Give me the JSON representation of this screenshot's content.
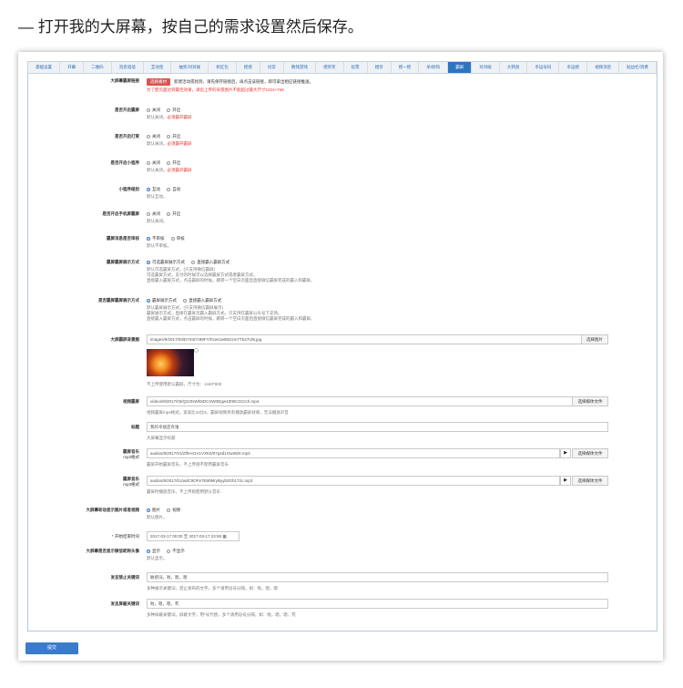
{
  "heading": "— 打开我的大屏幕，按自己的需求设置然后保存。",
  "tabs": [
    "基础设置",
    "开幕",
    "二维码",
    "消息墙墙",
    "互动签",
    "抽奖/对对碰",
    "抢红包",
    "摇摇",
    "问答",
    "数钱游戏",
    "摇奖奖",
    "投票",
    "相亲",
    "摇一摇",
    "杀/射钩",
    "霸屏",
    "对对碰",
    "大转盘",
    "幸运号码",
    "幸运榜",
    "视频消息",
    "贴边栏/消费"
  ],
  "active_tab": "霸屏",
  "form": {
    "bg_upload": {
      "label": "大屏幕霸屏链接",
      "button": "选择素材",
      "text": "新建活动或找到，请先保存链接后，再点击该链接，即可拿出相应链接推送。",
      "note": "为了使页面达到最佳效果，请您上传的背景图片不能超过最大尺寸1024×768"
    },
    "open_screen": {
      "label": "是否开启霸屏",
      "opt1": "关闭",
      "opt2": "开启",
      "hint": "默认关闭，",
      "hint_red": "必须霸开霸屏"
    },
    "open_danmu": {
      "label": "是否开启打赏",
      "opt1": "关闭",
      "opt2": "开启",
      "hint": "默认关闭，",
      "hint_red": "必须霸开霸屏"
    },
    "open_gift": {
      "label": "是否开启小程序",
      "opt1": "关闭",
      "opt2": "开启",
      "hint": "默认关闭，",
      "hint_red": "必须霸开霸屏"
    },
    "mini_level": {
      "label": "小程序级别",
      "opt1": "互动",
      "opt2": "自动",
      "hint": "默认互动。"
    },
    "phone_screen": {
      "label": "是否开启手机屏霸屏",
      "opt1": "关闭",
      "opt2": "开启",
      "hint": "默认关闭。"
    },
    "msg_review": {
      "label": "霸屏消息是否审核",
      "opt1": "不审核",
      "opt2": "审核",
      "hint": "默认不审核。"
    },
    "pay_method": {
      "label": "霸屏霸屏展示方式",
      "opt1": "可选霸屏展示方式",
      "opt2": "直接霸入霸屏方式",
      "hints": [
        "默认可选霸屏方式，(只支持微信霸屏)",
        "可选霸屏方式，支付的时候可以选择霸屏方式或者霸屏方式。",
        "直接霸入霸屏方式，点击霸屏的时候，跳转一个空白页面后直接微信霸屏完成的霸入和霸屏。"
      ]
    },
    "show_method": {
      "label": "是否霸屏霸屏展示方式",
      "opt1": "霸屏展示方式",
      "opt2": "直接霸入霸屏方式",
      "hints": [
        "默认霸屏展示方式，(只支持微信霸屏展示)",
        "霸屏展示方式，直接在霸屏页霸入霸屏方式，只支持在霸屏公众号下支持。",
        "直接霸入霸屏方式，点击霸屏的时候，跳转一个空白页面后直接微信霸屏完成的霸入和霸屏。"
      ]
    },
    "bg_image": {
      "label": "大屏霸屏背景图",
      "value": "images/9/2017/03/D7m57z99FYrhzwrzw85Ozm7Tb47Ul6.jpg",
      "button": "选择图片",
      "hint": "不上传使用默认霸屏，尺寸为：1440*900"
    },
    "bg_video": {
      "label": "视频霸屏",
      "value": "videos/9/2017/03/Q2z0sWh5DCXW0Dgw4Zt9ICGCIch.mp4",
      "button": "选择媒体文件",
      "hint": "视频霸屏mp4格式，宽高比16比9，霸屏视频另有播放霸屏效果，无法播放声音"
    },
    "title": {
      "label": "标题",
      "value": "我的幸福还有谁",
      "hint": "大屏幕显示标题"
    },
    "bg_music": {
      "label": "霸屏音乐",
      "sub": "mp3格式",
      "value": "audios/9/2017/01/ZfhH41V1VXK0/07q4d1Gw29/rt.mp3",
      "button": "选择媒体文件",
      "hint": "霸屏开始霸屏音乐，不上传则不使用霸屏音乐"
    },
    "end_music": {
      "label": "霸屏音乐",
      "sub": "mp3格式",
      "value": "audios/9/2017/01/wdC9OFe7E80MryByyb3Gh172c.mp3",
      "button": "选择媒体文件",
      "hint": "霸屏时播放音乐，不上传则使用默认音乐"
    },
    "show_type": {
      "label": "大屏幕轮动显示图片或者视频",
      "opt1": "图片",
      "opt2": "视频",
      "hint": "默认图片。"
    },
    "time_range": {
      "label": "* 开始结束时间",
      "value": "2017-03-17 00:00 至 2017-03-17 23:59"
    },
    "show_nick": {
      "label": "大屏幕是否显示微信昵称头像",
      "opt1": "显示",
      "opt2": "不显示",
      "hint": "默认显示。"
    },
    "ban_words": {
      "label": "发言禁止关键词",
      "value": "敏感词，啦，嗯，嗯",
      "hint": "多种展示关键词，禁止发布的文字，多个请用逗号分隔，如：啦，嗯，嗯"
    },
    "filter_words": {
      "label": "发言屏蔽关键词",
      "value": "啦，嗯，嗯，死",
      "hint": "多种屏蔽关键词，屏蔽文字，用*号代替，多个请用逗号分隔，如：啦，嗯，嗯，死"
    }
  },
  "submit": "提交"
}
